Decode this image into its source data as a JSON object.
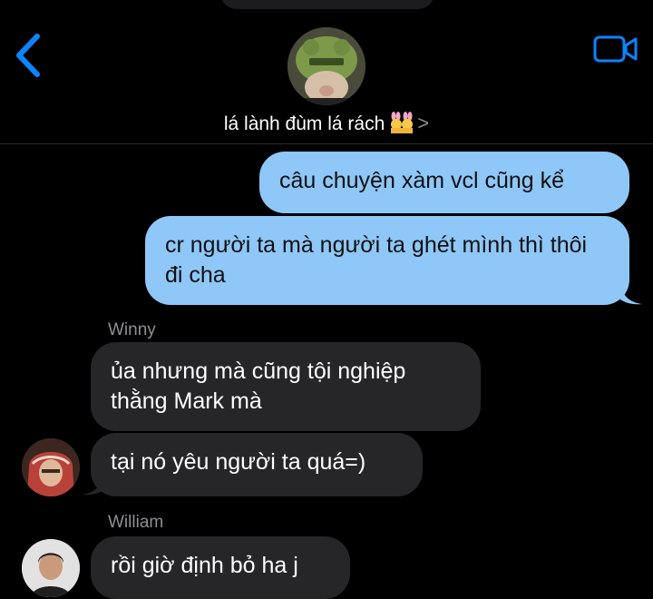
{
  "header": {
    "group_name": "lá lành đùm lá rách",
    "emoji_icon": "people-with-bunny-ears-icon",
    "chevron": ">",
    "icons": {
      "back": "chevron-left-icon",
      "video": "video-call-icon",
      "group_avatar": "frog-hat-avatar"
    }
  },
  "messages": [
    {
      "side": "outgoing",
      "text": "câu chuyện xàm vcl cũng kể"
    },
    {
      "side": "outgoing",
      "text": "cr người ta mà người ta ghét mình thì thôi đi cha"
    },
    {
      "side": "incoming",
      "sender": "Winny",
      "text": "ủa nhưng mà cũng tội nghiệp thằng Mark mà"
    },
    {
      "side": "incoming",
      "text": "tại nó yêu người ta quá=)"
    },
    {
      "side": "incoming",
      "sender": "William",
      "text": "rồi giờ định bỏ ha j"
    }
  ],
  "colors": {
    "accent": "#0a84ff",
    "outgoing_bubble": "#8ec7f8",
    "incoming_bubble": "#262628",
    "background": "#000000",
    "secondary_text": "#8e8e93"
  }
}
